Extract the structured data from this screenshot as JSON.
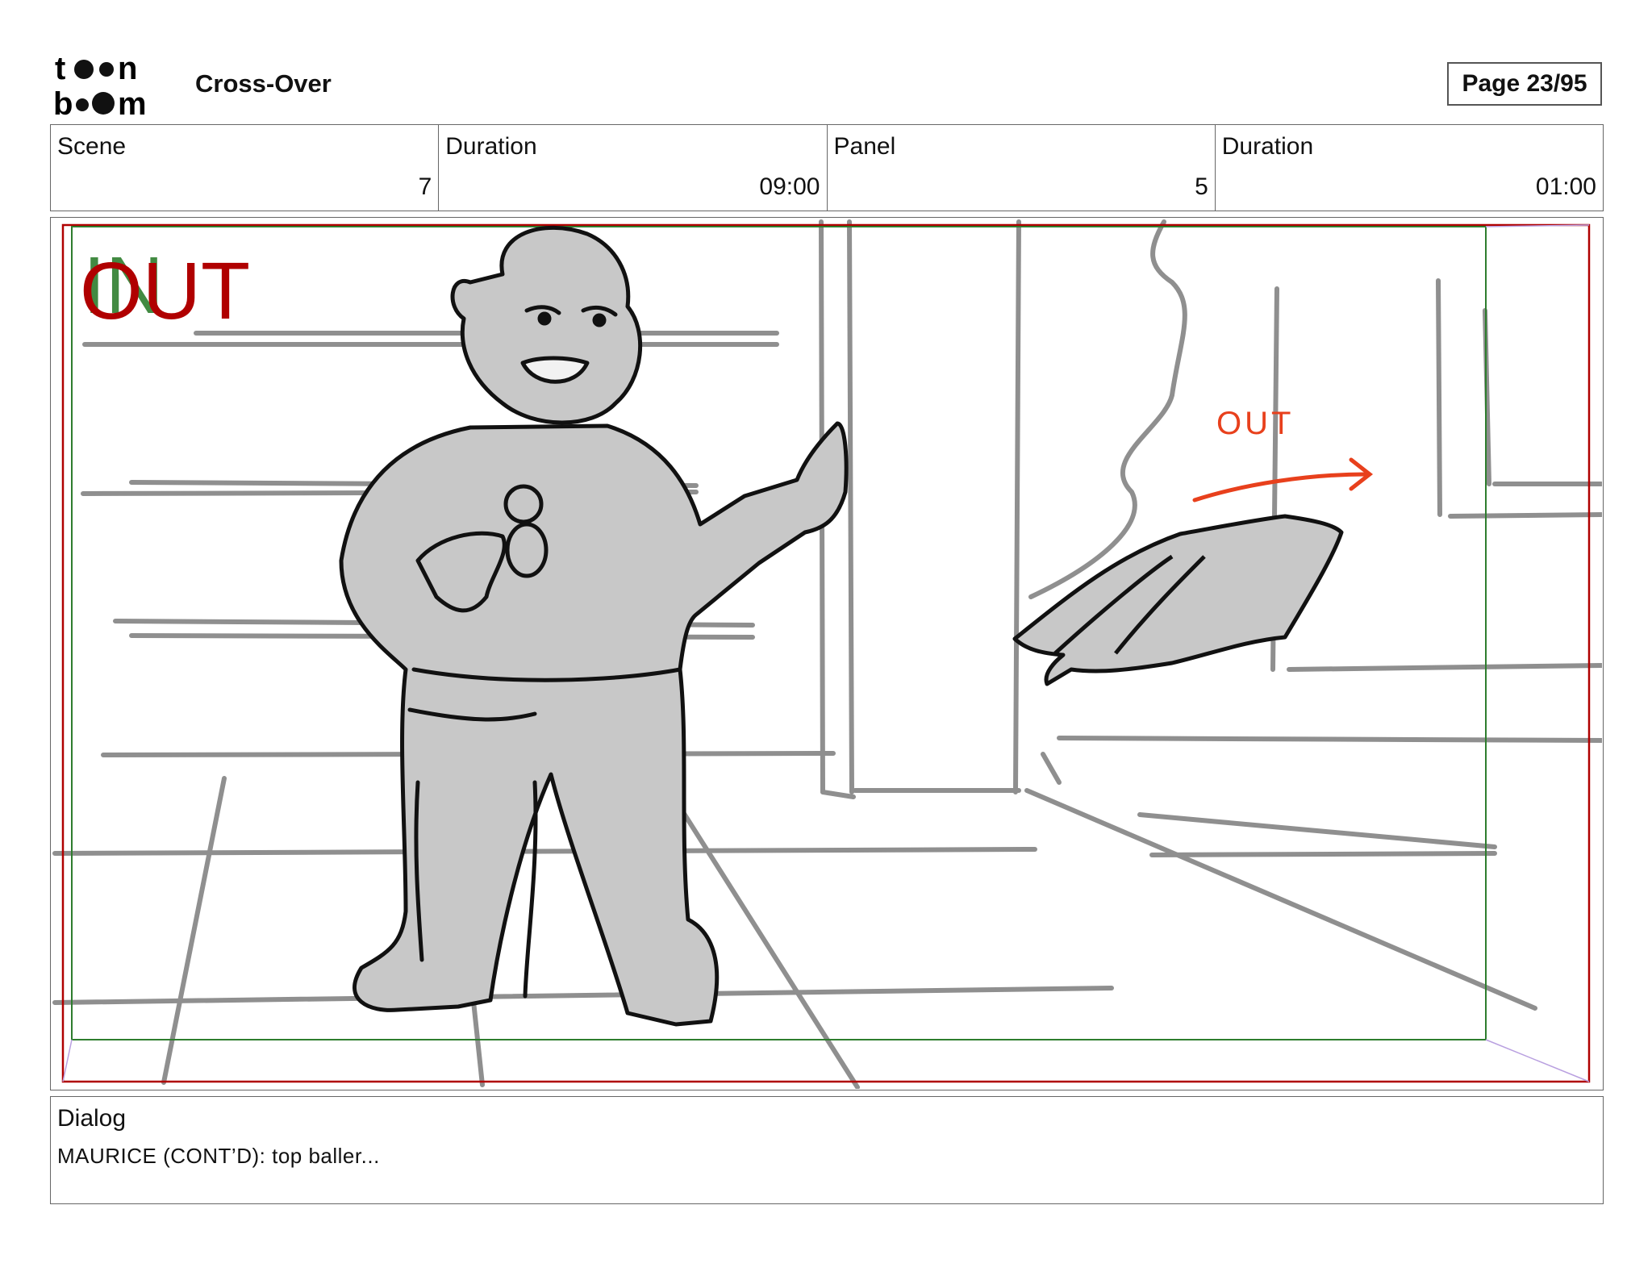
{
  "header": {
    "logo_text": "toon boom",
    "project_title": "Cross-Over",
    "page_indicator": "Page 23/95"
  },
  "info": {
    "scene_label": "Scene",
    "scene_value": "7",
    "scene_duration_label": "Duration",
    "scene_duration_value": "09:00",
    "panel_label": "Panel",
    "panel_value": "5",
    "panel_duration_label": "Duration",
    "panel_duration_value": "01:00"
  },
  "panel": {
    "camera_in_label": "IN",
    "camera_out_label": "OUT",
    "note_out": "OUT",
    "colors": {
      "camera_red": "#b00000",
      "camera_green": "#2e7d2e",
      "note_orange": "#e8401c",
      "fill_gray": "#c8c8c8",
      "line_gray": "#8f8f8f",
      "ink": "#111111"
    }
  },
  "dialog": {
    "label": "Dialog",
    "text": "MAURICE (CONT’D):  top baller..."
  }
}
